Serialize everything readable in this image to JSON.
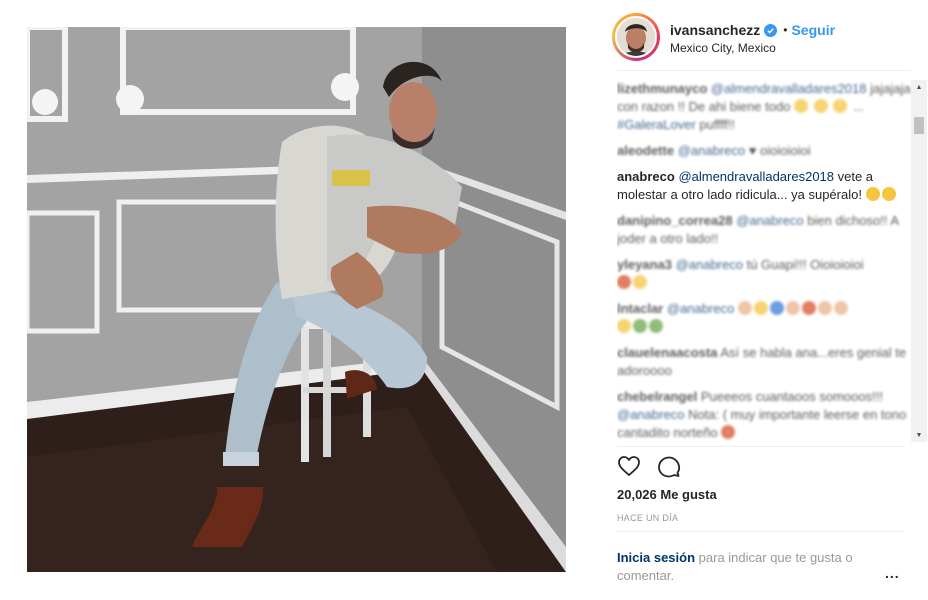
{
  "post": {
    "username": "ivansanchezz",
    "verified": true,
    "follow_label": "Seguir",
    "location": "Mexico City, Mexico",
    "likes": "20,026 Me gusta",
    "timestamp": "HACE UN DÍA",
    "login_link": "Inicia sesión",
    "login_rest": " para indicar que te gusta o comentar.",
    "more_label": "..."
  },
  "comments": [
    {
      "user": "lizethmunayco",
      "mention": "@almendravalladares2018",
      "text": " jajajaja con razon !! De ahi biene todo",
      "emojis": [
        "y",
        "y",
        "y"
      ],
      "tail_mention": "#GaleraLover",
      "tail": " puffff!!",
      "blurred": true
    },
    {
      "user": "aleodette",
      "mention": "@anabreco",
      "text": " ♥ oioioioioi",
      "emojis": [],
      "blurred": true
    },
    {
      "user": "anabreco",
      "mention": "@almendravalladares2018",
      "text": " vete a molestar a otro lado ridicula... ya supéralo!",
      "emojis": [
        "y",
        "y"
      ],
      "blurred": false
    },
    {
      "user": "danipino_correa28",
      "mention": "@anabreco",
      "text": " bien dichoso!! A joder a otro lado!!",
      "emojis": [],
      "blurred": true
    },
    {
      "user": "yleyana3",
      "mention": "@anabreco",
      "text": " tú Guapi!!! Oioioioioi",
      "emojis": [
        "r",
        "y"
      ],
      "blurred": true
    },
    {
      "user": "lntaclar",
      "mention": "@anabreco",
      "text": "",
      "emojis": [
        "s",
        "y",
        "b",
        "s",
        "r",
        "s",
        "s",
        "y",
        "g",
        "g"
      ],
      "blurred": true
    },
    {
      "user": "clauelenaacosta",
      "mention": "",
      "text": " Así se habla ana...eres genial te adoroooo",
      "emojis": [],
      "blurred": true
    },
    {
      "user": "chebelrangel",
      "mention": "",
      "text": " Pueeeos cuantaoos somooos!!!",
      "emojis": [],
      "mention2": "@anabreco",
      "text2": " Nota: ( muy importante leerse en tono cantadito norteño",
      "emojis2": [
        "r"
      ],
      "blurred": true
    }
  ],
  "icons": {
    "like": "heart-icon",
    "comment": "comment-bubble-icon",
    "verified": "verified-badge-icon",
    "more": "more-options-icon"
  },
  "colors": {
    "link": "#3897f0",
    "text": "#262626",
    "muted": "#999999",
    "mention": "#003569"
  }
}
